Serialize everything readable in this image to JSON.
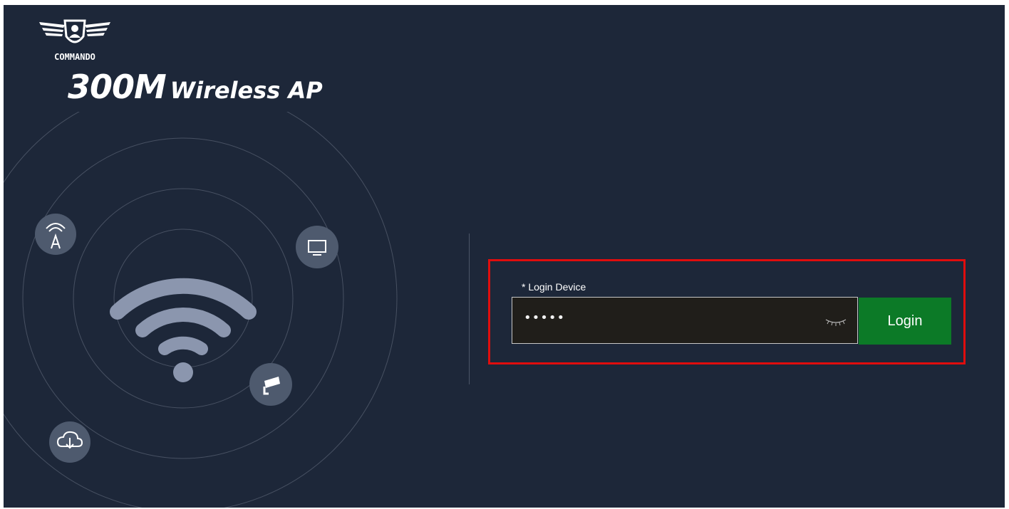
{
  "brand": {
    "logo_text": "COMMANDO",
    "title_main": "300M",
    "title_sub": "Wireless AP"
  },
  "illustration": {
    "icons": [
      "antenna-tower-icon",
      "monitor-icon",
      "wifi-icon",
      "security-camera-icon",
      "cloud-download-icon"
    ]
  },
  "login": {
    "label": "* Login Device",
    "password_mask": "•••••",
    "button_label": "Login",
    "highlight_color": "#e00d0d"
  },
  "colors": {
    "background": "#1d2739",
    "button": "#0c7a27"
  }
}
